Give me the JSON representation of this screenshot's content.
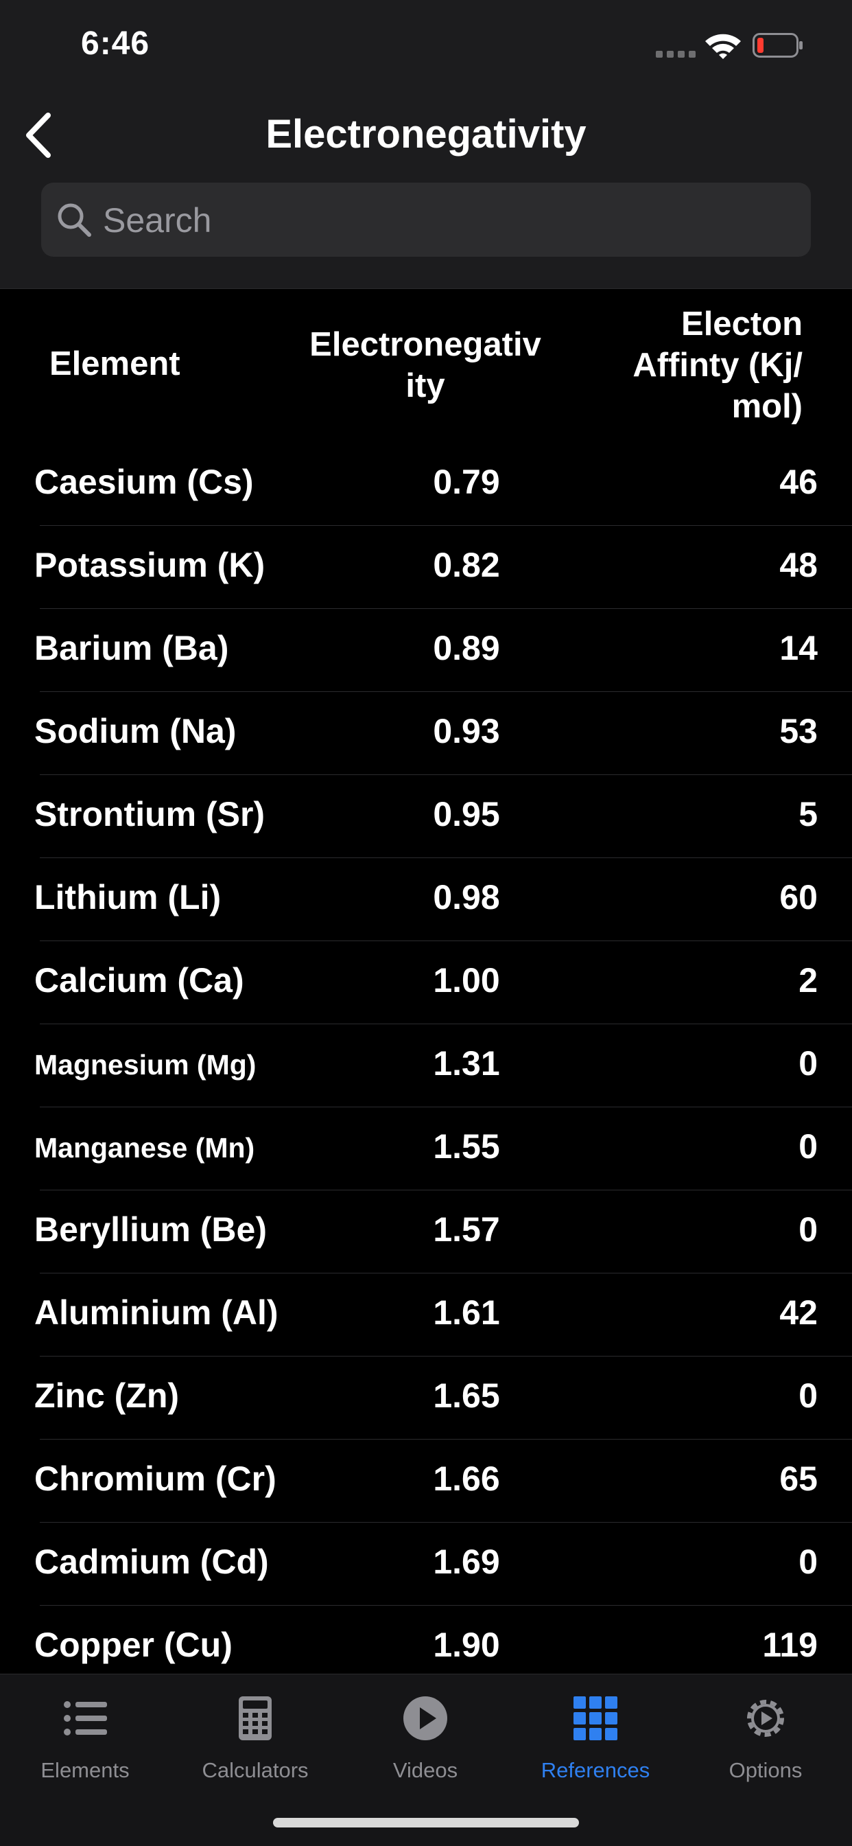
{
  "status_bar": {
    "time": "6:46"
  },
  "nav": {
    "title": "Electronegativity"
  },
  "search": {
    "placeholder": "Search",
    "value": ""
  },
  "table": {
    "headers": [
      "Element",
      "Electronegativ ity",
      "Electon Affinty (Kj/ mol)"
    ],
    "rows": [
      {
        "element": "Caesium (Cs)",
        "en": "0.79",
        "ea": "46"
      },
      {
        "element": "Potassium (K)",
        "en": "0.82",
        "ea": "48"
      },
      {
        "element": "Barium (Ba)",
        "en": "0.89",
        "ea": "14"
      },
      {
        "element": "Sodium (Na)",
        "en": "0.93",
        "ea": "53"
      },
      {
        "element": "Strontium (Sr)",
        "en": "0.95",
        "ea": "5"
      },
      {
        "element": "Lithium (Li)",
        "en": "0.98",
        "ea": "60"
      },
      {
        "element": "Calcium (Ca)",
        "en": "1.00",
        "ea": "2"
      },
      {
        "element": "Magnesium (Mg)",
        "en": "1.31",
        "ea": "0"
      },
      {
        "element": "Manganese (Mn)",
        "en": "1.55",
        "ea": "0"
      },
      {
        "element": "Beryllium (Be)",
        "en": "1.57",
        "ea": "0"
      },
      {
        "element": "Aluminium (Al)",
        "en": "1.61",
        "ea": "42"
      },
      {
        "element": "Zinc (Zn)",
        "en": "1.65",
        "ea": "0"
      },
      {
        "element": "Chromium (Cr)",
        "en": "1.66",
        "ea": "65"
      },
      {
        "element": "Cadmium (Cd)",
        "en": "1.69",
        "ea": "0"
      },
      {
        "element": "Copper (Cu)",
        "en": "1.90",
        "ea": "119"
      }
    ]
  },
  "tabbar": {
    "tabs": [
      {
        "label": "Elements",
        "icon": "list-icon"
      },
      {
        "label": "Calculators",
        "icon": "calculator-icon"
      },
      {
        "label": "Videos",
        "icon": "play-icon"
      },
      {
        "label": "References",
        "icon": "grid-icon"
      },
      {
        "label": "Options",
        "icon": "gear-icon"
      }
    ],
    "active_index": 3
  },
  "colors": {
    "accent": "#2f80f0",
    "inactive": "#8e8e93",
    "battery_low": "#ff3b30"
  }
}
